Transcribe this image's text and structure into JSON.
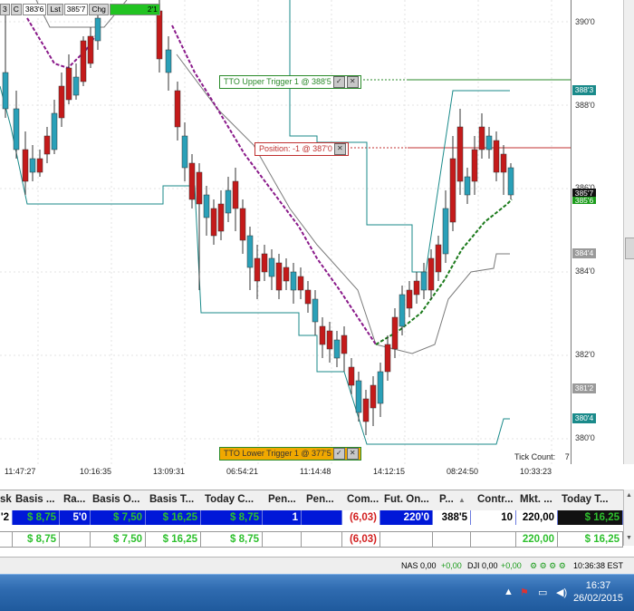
{
  "top_quote": {
    "f1": "3",
    "f2": "C",
    "f3": "383'6",
    "f4": "Lst",
    "f5": "385'7",
    "f6": "Chg",
    "f7": "2'1"
  },
  "price_axis": {
    "ticks": [
      "390'0",
      "388'0",
      "386'0",
      "384'0",
      "382'0",
      "380'0"
    ],
    "badges": [
      {
        "text": "388'3",
        "color": "#1a8a8a"
      },
      {
        "text": "385'7",
        "color": "#111111"
      },
      {
        "text": "385'6",
        "color": "#1b9c1b"
      },
      {
        "text": "384'4",
        "color": "#9a9a9a"
      },
      {
        "text": "381'2",
        "color": "#9a9a9a"
      },
      {
        "text": "380'4",
        "color": "#1a8a8a"
      }
    ]
  },
  "time_axis": {
    "labels": [
      "11:47:27",
      "10:16:35",
      "13:09:31",
      "06:54:21",
      "11:14:48",
      "14:12:15",
      "08:24:50",
      "10:33:23"
    ]
  },
  "chart_overlays": {
    "upper_trigger": "TTO Upper Trigger 1 @ 388'5",
    "position": "Position: -1 @ 387'0",
    "lower_trigger": "TTO Lower Trigger 1 @ 377'5",
    "tick_count_label": "Tick Count:",
    "tick_count_value": "7"
  },
  "colors": {
    "up_candle": "#2aa0b8",
    "down_candle": "#c41a1a",
    "ema_down": "#8a1a8a",
    "ema_up": "#1b7a1b",
    "channel_upper": "#1a8a8a",
    "channel_inner": "#7a7a7a",
    "upper_trigger": "#2a8a2a",
    "position_line": "#c03030",
    "lower_trigger_bg": "#f0a800"
  },
  "grid": {
    "headers": [
      "sk",
      "Basis ...",
      "Ra...",
      "Basis O...",
      "Basis T...",
      "Today C...",
      "Pen...",
      "Pen...",
      "Com...",
      "Fut. On...",
      "P...",
      "Contr...",
      "Mkt. ...",
      "Today T..."
    ],
    "row1": [
      "'2",
      "$ 8,75",
      "5'0",
      "$ 7,50",
      "$ 16,25",
      "$ 8,75",
      "1",
      "",
      "(6,03)",
      "220'0",
      "388'5",
      "10",
      "220,00",
      "$ 16,25"
    ],
    "row2": [
      "",
      "$ 8,75",
      "",
      "$ 7,50",
      "$ 16,25",
      "$ 8,75",
      "",
      "",
      "(6,03)",
      "",
      "",
      "",
      "220,00",
      "$ 16,25"
    ]
  },
  "status_bar": {
    "nas": "NAS 0,00",
    "nas_chg": "+0,00",
    "dji": "DJI 0,00",
    "dji_chg": "+0,00",
    "time": "10:36:38 EST"
  },
  "taskbar": {
    "time": "16:37",
    "date": "26/02/2015"
  }
}
